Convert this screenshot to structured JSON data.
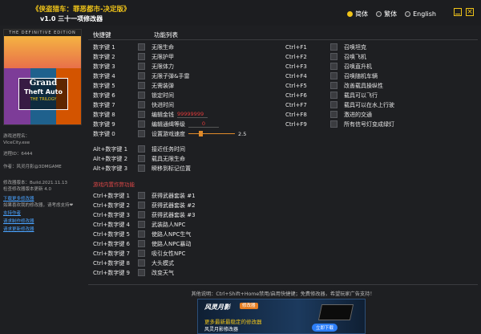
{
  "app": {
    "title": "《侠盗猎车：罪恶都市-决定版》",
    "subtitle": "v1.0 三十一项修改器"
  },
  "languages": [
    {
      "label": "简体",
      "selected": true
    },
    {
      "label": "繁体",
      "selected": false
    },
    {
      "label": "English",
      "selected": false
    }
  ],
  "sidebar": {
    "cover_banner": "THE DEFINITIVE EDITION",
    "cover_logo_line1": "Grand",
    "cover_logo_line2": "Theft Auto",
    "cover_logo_line3": "THE TRILOGY",
    "process_label": "游戏进程名：",
    "process_value": "ViceCity.exe",
    "pid_label": "进程ID：",
    "pid_value": "6444",
    "author": "作者：风灵月影@3DMGAME",
    "build_line1": "修改器版本：Build.2021.11.13",
    "build_line2": "检查修改器版本更新 4.0",
    "link_download": "下载更多修改器",
    "support_line": "如果喜欢我的修改器，请考虑支持❤",
    "link_support": "支持作者",
    "link_request": "请求制作修改器",
    "link_update": "请求更新修改器"
  },
  "headers": {
    "hotkey": "快捷键",
    "function": "功能列表"
  },
  "cheats_left": [
    {
      "key": "数字键 1",
      "name": "无限生命"
    },
    {
      "key": "数字键 2",
      "name": "无限护甲"
    },
    {
      "key": "数字键 3",
      "name": "无限体力"
    },
    {
      "key": "数字键 4",
      "name": "无限子弹&手雷"
    },
    {
      "key": "数字键 5",
      "name": "无需装弹"
    },
    {
      "key": "数字键 6",
      "name": "锁定时间"
    },
    {
      "key": "数字键 7",
      "name": "快进时间"
    },
    {
      "key": "数字键 8",
      "name": "编辑金钱",
      "input": "99999999"
    },
    {
      "key": "数字键 9",
      "name": "编辑通缉等级",
      "input": "0"
    },
    {
      "key": "数字键 0",
      "name": "设置游戏速度",
      "slider": 2.5
    }
  ],
  "cheats_right": [
    {
      "key": "Ctrl+F1",
      "name": "召唤坦克"
    },
    {
      "key": "Ctrl+F2",
      "name": "召唤飞机"
    },
    {
      "key": "Ctrl+F3",
      "name": "召唤直升机"
    },
    {
      "key": "Ctrl+F4",
      "name": "召唤随机车辆"
    },
    {
      "key": "Ctrl+F5",
      "name": "改善载具操纵性"
    },
    {
      "key": "Ctrl+F6",
      "name": "载具可以飞行"
    },
    {
      "key": "Ctrl+F7",
      "name": "载具可以在水上行驶"
    },
    {
      "key": "Ctrl+F8",
      "name": "激进的交通"
    },
    {
      "key": "Ctrl+F9",
      "name": "所有信号灯变成绿灯"
    }
  ],
  "cheats_alt": [
    {
      "key": "Alt+数字键 1",
      "name": "接近任务时间"
    },
    {
      "key": "Alt+数字键 2",
      "name": "载具无限生命"
    },
    {
      "key": "Alt+数字键 3",
      "name": "瞬移到标记位置"
    }
  ],
  "ingame_section_label": "游戏内置作弊功能",
  "cheats_ctrl": [
    {
      "key": "Ctrl+数字键 1",
      "name": "获得武器套装 #1"
    },
    {
      "key": "Ctrl+数字键 2",
      "name": "获得武器套装 #2"
    },
    {
      "key": "Ctrl+数字键 3",
      "name": "获得武器套装 #3"
    },
    {
      "key": "Ctrl+数字键 4",
      "name": "武装路人NPC"
    },
    {
      "key": "Ctrl+数字键 5",
      "name": "使路人NPC生气"
    },
    {
      "key": "Ctrl+数字键 6",
      "name": "使路人NPC暴动"
    },
    {
      "key": "Ctrl+数字键 7",
      "name": "吸引女性NPC"
    },
    {
      "key": "Ctrl+数字键 8",
      "name": "大头模式"
    },
    {
      "key": "Ctrl+数字键 9",
      "name": "改变天气"
    }
  ],
  "footer": {
    "note": "其他说明：Ctrl+Shift+Home禁用/启用快捷键；免费修改器，希望玩家广告支持！",
    "ad_brand": "风灵月影",
    "ad_pill": "修改器",
    "ad_line1": "更多最新最稳定的修改器",
    "ad_line2": "风灵月影修改器",
    "ad_button": "立即下载"
  },
  "colors": {
    "accent": "#f0c419",
    "value_red": "#e03a3a",
    "slider_orange": "#e08a2a",
    "section_red": "#e04848",
    "link_blue": "#4aa3ff",
    "background": "#1e1f22"
  }
}
